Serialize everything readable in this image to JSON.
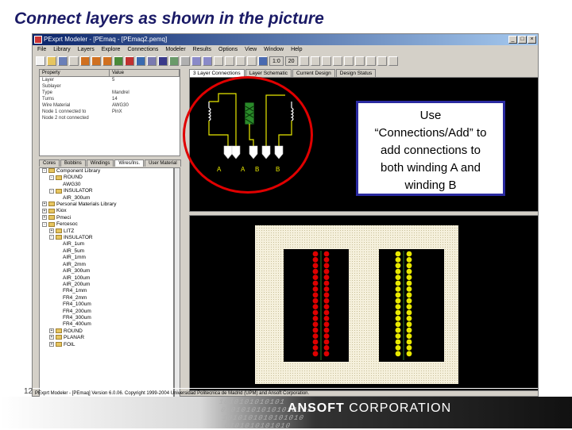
{
  "slide": {
    "title": "Connect layers as shown in the picture",
    "page_number": "12"
  },
  "window": {
    "title": "PExprt Modeler - [PEmaq - [PEmaq2.pemq]",
    "buttons": [
      "_",
      "□",
      "×"
    ]
  },
  "menu": [
    "File",
    "Library",
    "Layers",
    "Explore",
    "Connections",
    "Modeler",
    "Results",
    "Options",
    "View",
    "Window",
    "Help"
  ],
  "toolbar": {
    "zoom_a": "1:0",
    "zoom_b": "20"
  },
  "properties": {
    "headers": [
      "Property",
      "Value"
    ],
    "rows": [
      [
        "Layer",
        "5"
      ],
      [
        "Sublayer",
        ""
      ],
      [
        "Type",
        "Mandrel"
      ],
      [
        "Turns",
        "14"
      ],
      [
        "Wire Material",
        "AWG30"
      ],
      [
        "Node 1 connected to",
        "PinX"
      ],
      [
        "Node 2 not connected",
        ""
      ]
    ]
  },
  "left_tabs": [
    "Cores",
    "Bobbins",
    "Windings",
    "Wires/Ins.",
    "User Material"
  ],
  "tree": [
    {
      "level": 0,
      "toggle": "-",
      "label": "Component Library",
      "folder": true
    },
    {
      "level": 1,
      "toggle": "-",
      "label": "ROUND",
      "folder": true
    },
    {
      "level": 2,
      "toggle": "",
      "label": "AWG30",
      "folder": false
    },
    {
      "level": 1,
      "toggle": "-",
      "label": "INSULATOR",
      "folder": true
    },
    {
      "level": 2,
      "toggle": "",
      "label": "AIR_300um",
      "folder": false
    },
    {
      "level": 0,
      "toggle": "+",
      "label": "Personal Materials Library",
      "folder": true
    },
    {
      "level": 0,
      "toggle": "+",
      "label": "Kiox",
      "folder": true
    },
    {
      "level": 0,
      "toggle": "+",
      "label": "Pmeci",
      "folder": true
    },
    {
      "level": 0,
      "toggle": "-",
      "label": "Fercesoc",
      "folder": true
    },
    {
      "level": 1,
      "toggle": "+",
      "label": "LITZ",
      "folder": true
    },
    {
      "level": 1,
      "toggle": "-",
      "label": "INSULATOR",
      "folder": true
    },
    {
      "level": 2,
      "toggle": "",
      "label": "AIR_1um",
      "folder": false
    },
    {
      "level": 2,
      "toggle": "",
      "label": "AIR_5um",
      "folder": false
    },
    {
      "level": 2,
      "toggle": "",
      "label": "AIR_1mm",
      "folder": false
    },
    {
      "level": 2,
      "toggle": "",
      "label": "AIR_2mm",
      "folder": false
    },
    {
      "level": 2,
      "toggle": "",
      "label": "AIR_300um",
      "folder": false
    },
    {
      "level": 2,
      "toggle": "",
      "label": "AIR_100um",
      "folder": false
    },
    {
      "level": 2,
      "toggle": "",
      "label": "AIR_200um",
      "folder": false
    },
    {
      "level": 2,
      "toggle": "",
      "label": "FR4_1mm",
      "folder": false
    },
    {
      "level": 2,
      "toggle": "",
      "label": "FR4_2mm",
      "folder": false
    },
    {
      "level": 2,
      "toggle": "",
      "label": "FR4_100um",
      "folder": false
    },
    {
      "level": 2,
      "toggle": "",
      "label": "FR4_200um",
      "folder": false
    },
    {
      "level": 2,
      "toggle": "",
      "label": "FR4_300um",
      "folder": false
    },
    {
      "level": 2,
      "toggle": "",
      "label": "FR4_400um",
      "folder": false
    },
    {
      "level": 1,
      "toggle": "+",
      "label": "ROUND",
      "folder": true
    },
    {
      "level": 1,
      "toggle": "+",
      "label": "PLANAR",
      "folder": true
    },
    {
      "level": 1,
      "toggle": "+",
      "label": "FOIL",
      "folder": true
    }
  ],
  "doc_tabs": [
    "3 Layer Connections",
    "Layer Schematic",
    "Current Design",
    "Design Status"
  ],
  "schematic": {
    "pin_labels": [
      "A",
      "A",
      "B",
      "B"
    ]
  },
  "status": "PExprt Modeler - [PEmaq] Version 6.0.06. Copyright 1999-2004 Universidad Politecnica de Madrid (UPM) and Ansoft Corporation.",
  "callout": {
    "lines": [
      "Use",
      "“Connections/Add” to",
      "add connections to",
      "both winding A and",
      "winding B"
    ]
  },
  "footer": {
    "binary_text": "1010101010101\n010101010101010101\n1010101010101010\n0101010101010",
    "brand_bold": "ANSOFT",
    "brand_rest": " CORPORATION"
  },
  "colors": {
    "title": "#1a1a66",
    "callout_border": "#2a2aa0",
    "highlight_ring": "#e00000",
    "winding_a": "#dd0000",
    "winding_b": "#e8e800",
    "core_fill": "#f5f0dc"
  }
}
